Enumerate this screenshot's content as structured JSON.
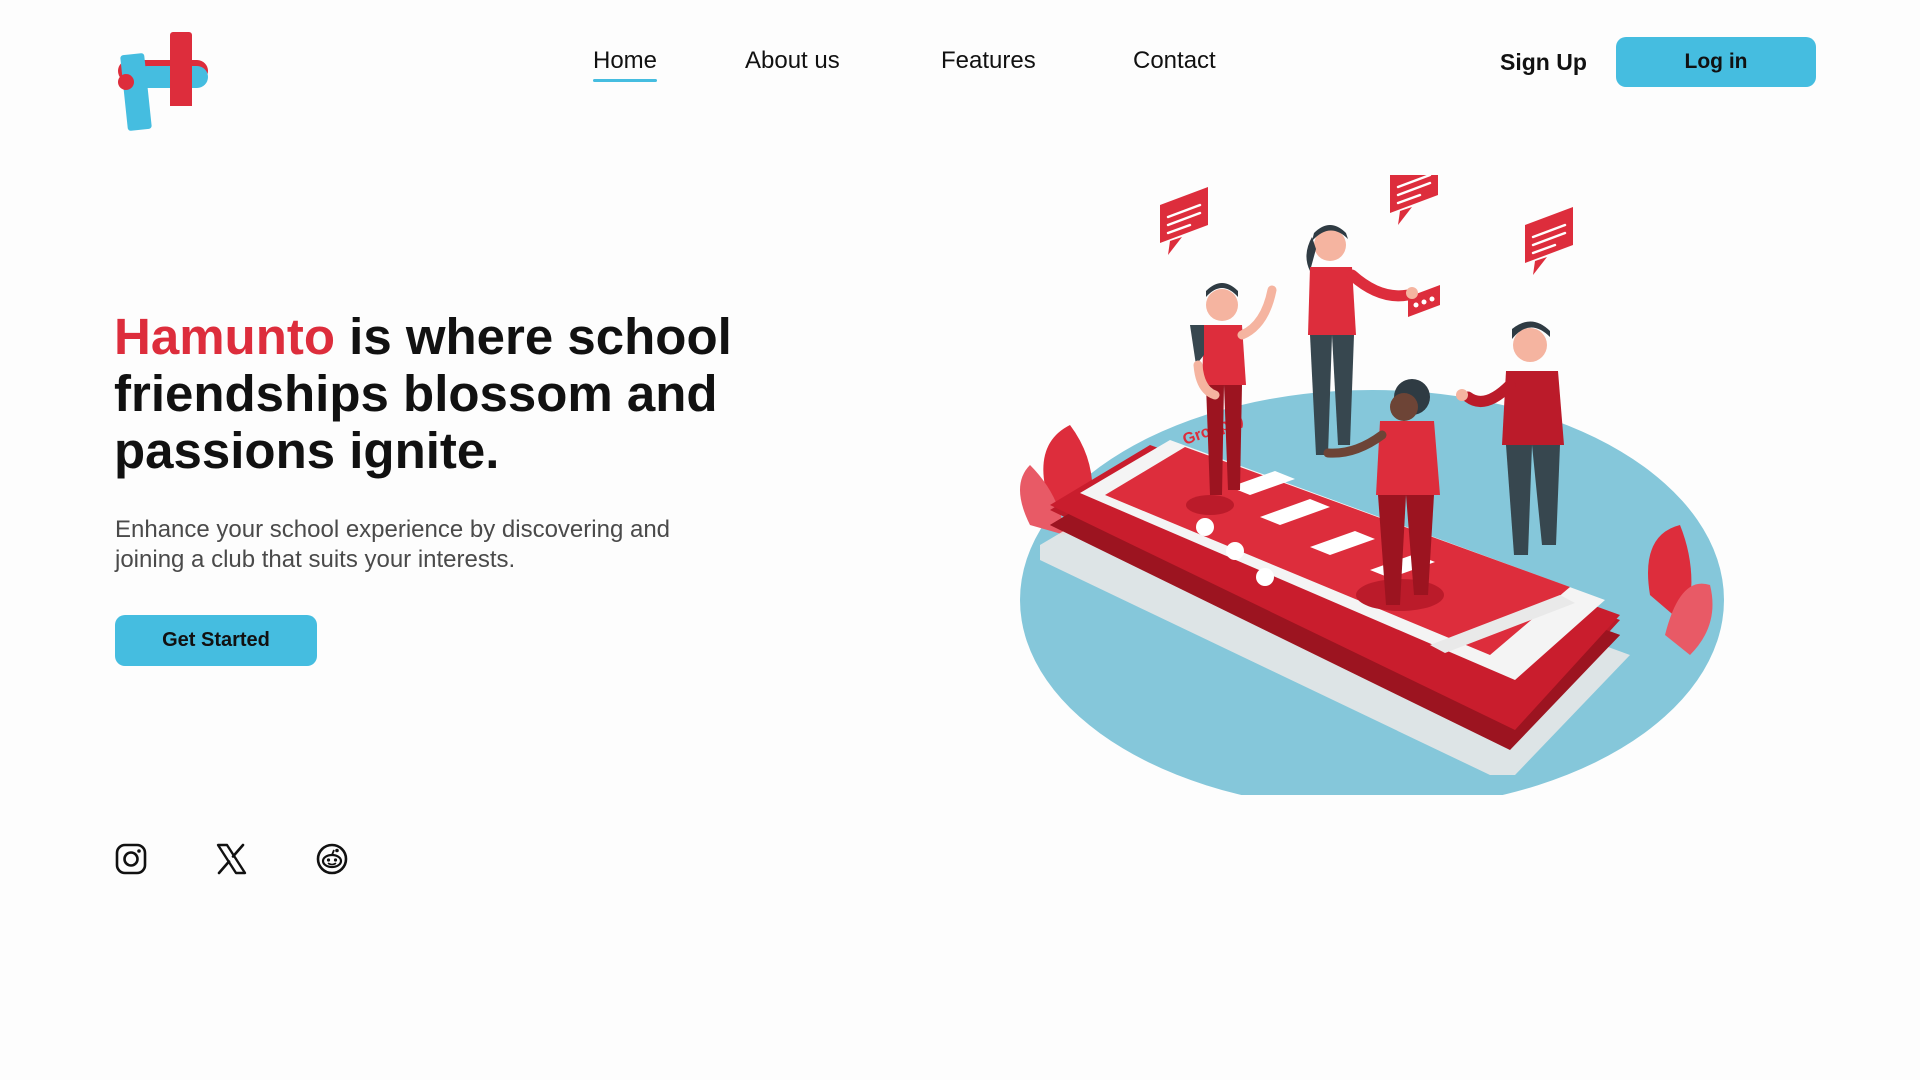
{
  "header": {
    "logo_icon": "hamunto-logo-icon",
    "nav": [
      {
        "label": "Home",
        "active": true
      },
      {
        "label": "About us",
        "active": false
      },
      {
        "label": "Features",
        "active": false
      },
      {
        "label": "Contact",
        "active": false
      }
    ],
    "signup_label": "Sign Up",
    "login_label": "Log in"
  },
  "hero": {
    "brand": "Hamunto",
    "title_rest": " is where school friendships blossom and passions ignite.",
    "subtitle": "Enhance your school experience by discovering and joining a club that suits your interests.",
    "cta_label": "Get Started"
  },
  "social": [
    {
      "icon": "instagram-icon"
    },
    {
      "icon": "x-twitter-icon"
    },
    {
      "icon": "reddit-icon"
    }
  ],
  "illustration": {
    "icon": "students-chatting-on-phone-illustration",
    "phone_group_label": "Group :)"
  },
  "colors": {
    "brand_red": "#dd2d3c",
    "accent_blue": "#45bde0",
    "ellipse_blue": "#85c7da"
  }
}
